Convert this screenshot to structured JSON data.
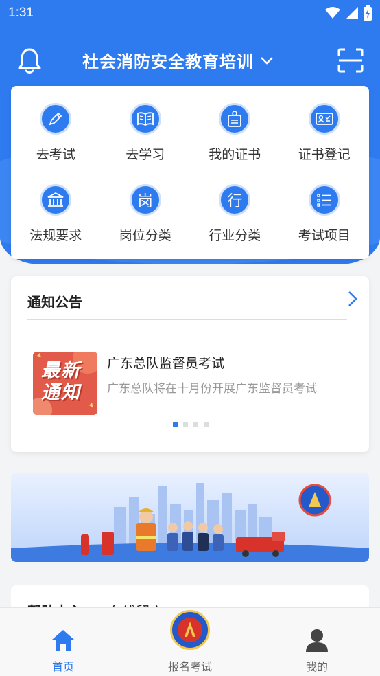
{
  "status_bar": {
    "time": "1:31"
  },
  "header": {
    "title": "社会消防安全教育培训"
  },
  "grid": [
    {
      "label": "去考试",
      "icon": "pencil-icon"
    },
    {
      "label": "去学习",
      "icon": "book-icon"
    },
    {
      "label": "我的证书",
      "icon": "badge-icon"
    },
    {
      "label": "证书登记",
      "icon": "id-card-icon"
    },
    {
      "label": "法规要求",
      "icon": "court-icon"
    },
    {
      "label": "岗位分类",
      "icon": "gang-char-icon",
      "glyph": "岗"
    },
    {
      "label": "行业分类",
      "icon": "xing-char-icon",
      "glyph": "行"
    },
    {
      "label": "考试项目",
      "icon": "list-icon"
    }
  ],
  "notice": {
    "title": "通知公告",
    "thumb_text": "最新\n通知",
    "headline": "广东总队监督员考试",
    "summary": "广东总队将在十月份开展广东监督员考试"
  },
  "help": {
    "label": "帮助中心",
    "label2": "在线留言"
  },
  "tabs": [
    {
      "label": "首页",
      "icon": "home-icon",
      "active": true
    },
    {
      "label": "报名考试",
      "icon": "emblem-icon",
      "active": false
    },
    {
      "label": "我的",
      "icon": "person-icon",
      "active": false
    }
  ],
  "colors": {
    "primary": "#2e7bf0",
    "background": "#f3f4f6"
  }
}
